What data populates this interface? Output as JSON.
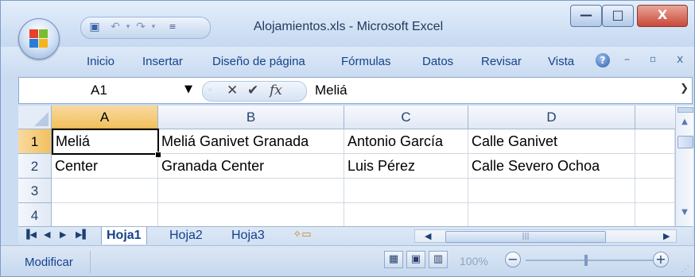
{
  "window": {
    "title": "Alojamientos.xls - Microsoft Excel",
    "controls": {
      "minimize": "—",
      "maximize": "□",
      "close": "X"
    }
  },
  "ribbon": {
    "tabs": [
      "Inicio",
      "Insertar",
      "Diseño de página",
      "Fórmulas",
      "Datos",
      "Revisar",
      "Vista"
    ],
    "help": "?",
    "mini_controls": [
      "–",
      "▫",
      "x"
    ]
  },
  "formula_bar": {
    "name_box": "A1",
    "formula": "Meliá",
    "fx": "fx"
  },
  "sheet": {
    "columns": [
      "A",
      "B",
      "C",
      "D"
    ],
    "rows": [
      "1",
      "2",
      "3",
      "4"
    ],
    "cells": [
      [
        "Meliá",
        "Meliá Ganivet Granada",
        "Antonio García",
        "Calle Ganivet"
      ],
      [
        "Center",
        "Granada Center",
        "Luis Pérez",
        "Calle Severo Ochoa"
      ],
      [
        "",
        "",
        "",
        ""
      ],
      [
        "",
        "",
        "",
        ""
      ]
    ],
    "active_cell": "A1"
  },
  "sheet_tabs": {
    "tabs": [
      "Hoja1",
      "Hoja2",
      "Hoja3"
    ],
    "active": "Hoja1"
  },
  "status_bar": {
    "mode": "Modificar",
    "zoom": "100%"
  },
  "colors": {
    "accent": "#15428b",
    "selected_header": "#f1c15f",
    "grid_line": "#d0d7e5"
  }
}
